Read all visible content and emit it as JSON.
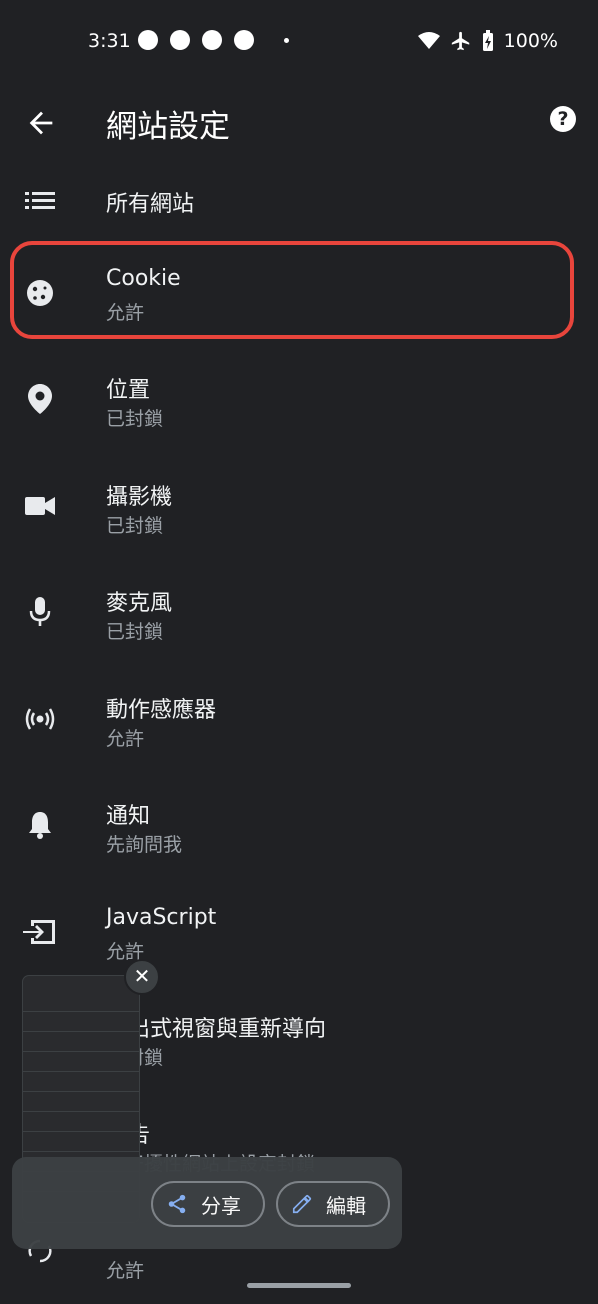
{
  "status": {
    "time": "3:31",
    "battery": "100%"
  },
  "header": {
    "title": "網站設定",
    "back_icon": "arrow-back-icon",
    "help_icon": "help-icon"
  },
  "items": [
    {
      "title": "所有網站",
      "subtitle": "",
      "icon": "list-icon"
    },
    {
      "title": "Cookie",
      "subtitle": "允許",
      "icon": "cookie-icon"
    },
    {
      "title": "位置",
      "subtitle": "已封鎖",
      "icon": "location-pin-icon"
    },
    {
      "title": "攝影機",
      "subtitle": "已封鎖",
      "icon": "camera-icon"
    },
    {
      "title": "麥克風",
      "subtitle": "已封鎖",
      "icon": "mic-icon"
    },
    {
      "title": "動作感應器",
      "subtitle": "允許",
      "icon": "sensors-icon"
    },
    {
      "title": "通知",
      "subtitle": "先詢問我",
      "icon": "bell-icon"
    },
    {
      "title": "JavaScript",
      "subtitle": "允許",
      "icon": "javascript-icon"
    },
    {
      "title": "彈出式視窗與重新導向",
      "subtitle": "已封鎖",
      "icon": "popup-icon"
    },
    {
      "title": "廣告",
      "subtitle": "在干擾性網站上設定封鎖",
      "icon": "ads-icon"
    },
    {
      "title": "",
      "subtitle": "允許",
      "icon": "sync-icon"
    }
  ],
  "sharebar": {
    "share_label": "分享",
    "edit_label": "編輯"
  },
  "colors": {
    "background": "#202124",
    "highlight": "#e8453c"
  }
}
